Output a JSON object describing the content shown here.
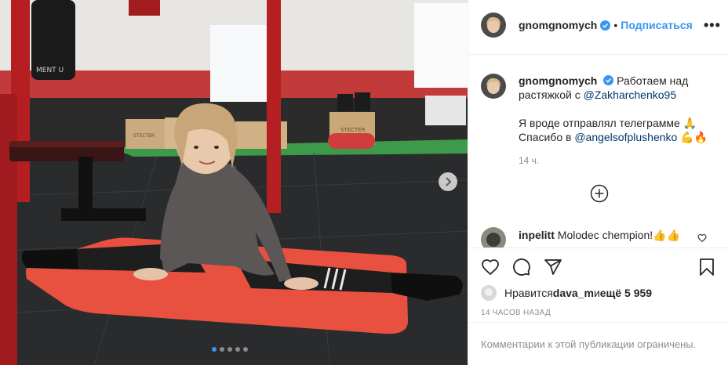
{
  "post": {
    "username": "gnomgnomych",
    "follow_label": "Подписаться",
    "more_label": "•••",
    "caption": {
      "part1": "Работаем над растяжкой с ",
      "mention1": "@Zakharchenko95",
      "line2": "Я вроде отправлял телеграмме 🙏",
      "line3_prefix": "Спасибо в ",
      "mention2": "@angelsofplushenko",
      "line3_suffix": " 💪🔥",
      "time": "14 ч."
    },
    "comment": {
      "username": "inpelitt",
      "text": "Molodec chempion!👍👍"
    },
    "likes": {
      "prefix": "Нравится ",
      "user": "dava_m",
      "middle": " и ",
      "count": "ещё 5 959"
    },
    "timestamp": "14 ЧАСОВ НАЗАД",
    "comments_disabled": "Комментарии к этой публикации ограничены."
  },
  "carousel": {
    "total": 5,
    "active_index": 0
  },
  "photo_text": {
    "sign1": "STECTER",
    "sign2": "STECTER",
    "bag_text": "MENT U"
  },
  "colors": {
    "link": "#00376b",
    "accent": "#3897f0",
    "muted": "#8e8e8e",
    "mat": "#e8513f"
  },
  "icons": [
    "verified-badge-icon",
    "heart-icon",
    "comment-icon",
    "share-icon",
    "save-icon",
    "plus-circle-icon",
    "chevron-right-icon"
  ]
}
